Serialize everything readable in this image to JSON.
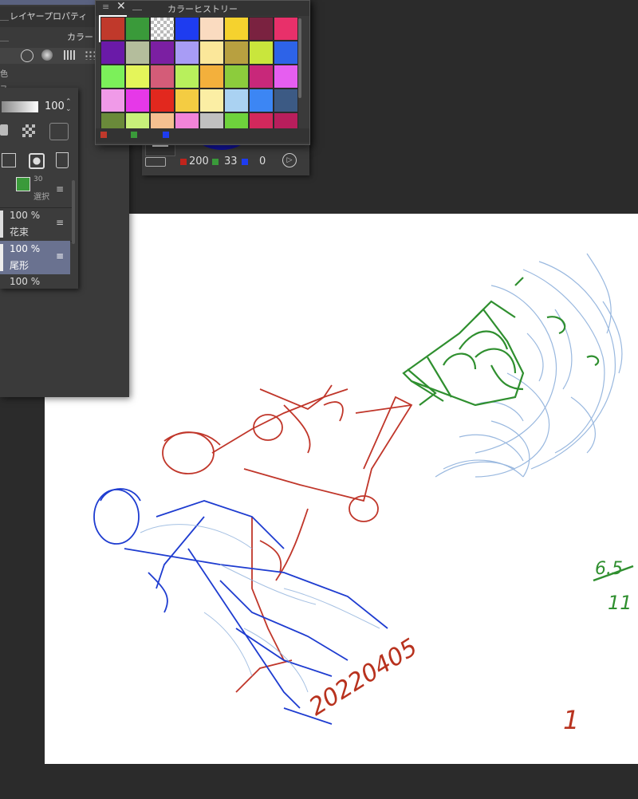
{
  "layer_property_panel": {
    "title": "レイヤープロパティ",
    "tab_color": "カラー",
    "color_label": "色",
    "layer_label": "フ"
  },
  "layer_panel": {
    "opacity_value": "100",
    "layers": [
      {
        "opacity": "30",
        "name": "選択"
      },
      {
        "opacity": "100 %",
        "name": "花束"
      },
      {
        "opacity": "100 %",
        "name": "尾形",
        "selected": true
      },
      {
        "opacity": "100 %",
        "name": ""
      }
    ]
  },
  "color_history": {
    "title": "カラーヒストリー",
    "swatches": [
      "#c0392b",
      "#3a9a3a",
      "checker",
      "#1e3cf0",
      "#fadbc0",
      "#f5d22e",
      "#7a2240",
      "#e8306a",
      "#6a1aa8",
      "#b4bd9c",
      "#7b1fa2",
      "#a89cf5",
      "#fbe79a",
      "#b8a040",
      "#c9e63c",
      "#2d63e8",
      "#7cf05a",
      "#e4f55a",
      "#d45c78",
      "#b8f05c",
      "#f3b03c",
      "#8ccc3c",
      "#c8287a",
      "#e65ef0",
      "#f09ae8",
      "#e638e8",
      "#e2281e",
      "#f4cc42",
      "#fbeea4",
      "#aad2f2",
      "#3c86f4",
      "#3c5a84",
      "#6a8a3a",
      "#c8f07a",
      "#f5c090",
      "#f284d8",
      "#c0c0c0",
      "#6ed23c",
      "#d2285c",
      "#b81e5c"
    ],
    "bottom_swatches": [
      "#c0392b",
      "#3a9a3a",
      "#1e3cf0"
    ]
  },
  "color_panel": {
    "r": "200",
    "g": "33",
    "b": "0",
    "colors": {
      "r": "#c0241c",
      "g": "#3a9a3a",
      "b": "#1e3cf0"
    }
  },
  "canvas_text": {
    "date_signature": "20220405",
    "side_note_top": "6.5",
    "side_note_bottom": "11",
    "page_mark": "1"
  }
}
